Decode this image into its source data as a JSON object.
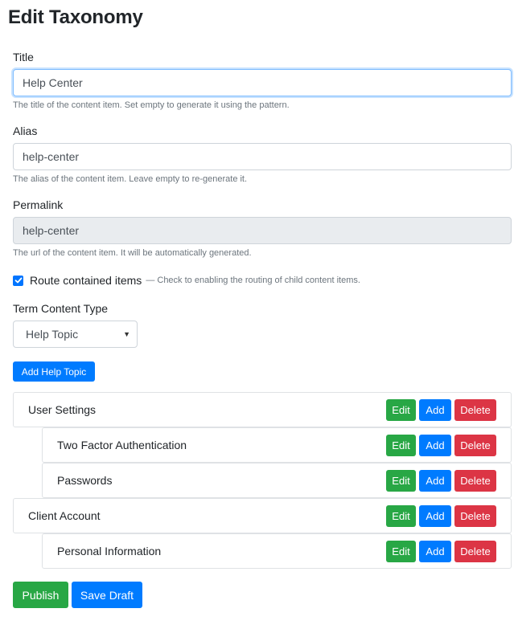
{
  "page_title": "Edit Taxonomy",
  "title_field": {
    "label": "Title",
    "value": "Help Center",
    "help": "The title of the content item. Set empty to generate it using the pattern."
  },
  "alias_field": {
    "label": "Alias",
    "value": "help-center",
    "help": "The alias of the content item. Leave empty to re-generate it."
  },
  "permalink_field": {
    "label": "Permalink",
    "value": "help-center",
    "help": "The url of the content item. It will be automatically generated."
  },
  "route_checkbox": {
    "checked": true,
    "label": "Route contained items",
    "note": "— Check to enabling the routing of child content items."
  },
  "term_type": {
    "label": "Term Content Type",
    "selected": "Help Topic"
  },
  "add_topic_label": "Add Help Topic",
  "tree": [
    {
      "label": "User Settings",
      "level": 0
    },
    {
      "label": "Two Factor Authentication",
      "level": 1
    },
    {
      "label": "Passwords",
      "level": 1
    },
    {
      "label": "Client Account",
      "level": 0
    },
    {
      "label": "Personal Information",
      "level": 1
    }
  ],
  "row_actions": {
    "edit": "Edit",
    "add": "Add",
    "delete": "Delete"
  },
  "footer": {
    "publish": "Publish",
    "save_draft": "Save Draft"
  },
  "colors": {
    "primary": "#007bff",
    "success": "#28a745",
    "danger": "#dc3545"
  }
}
